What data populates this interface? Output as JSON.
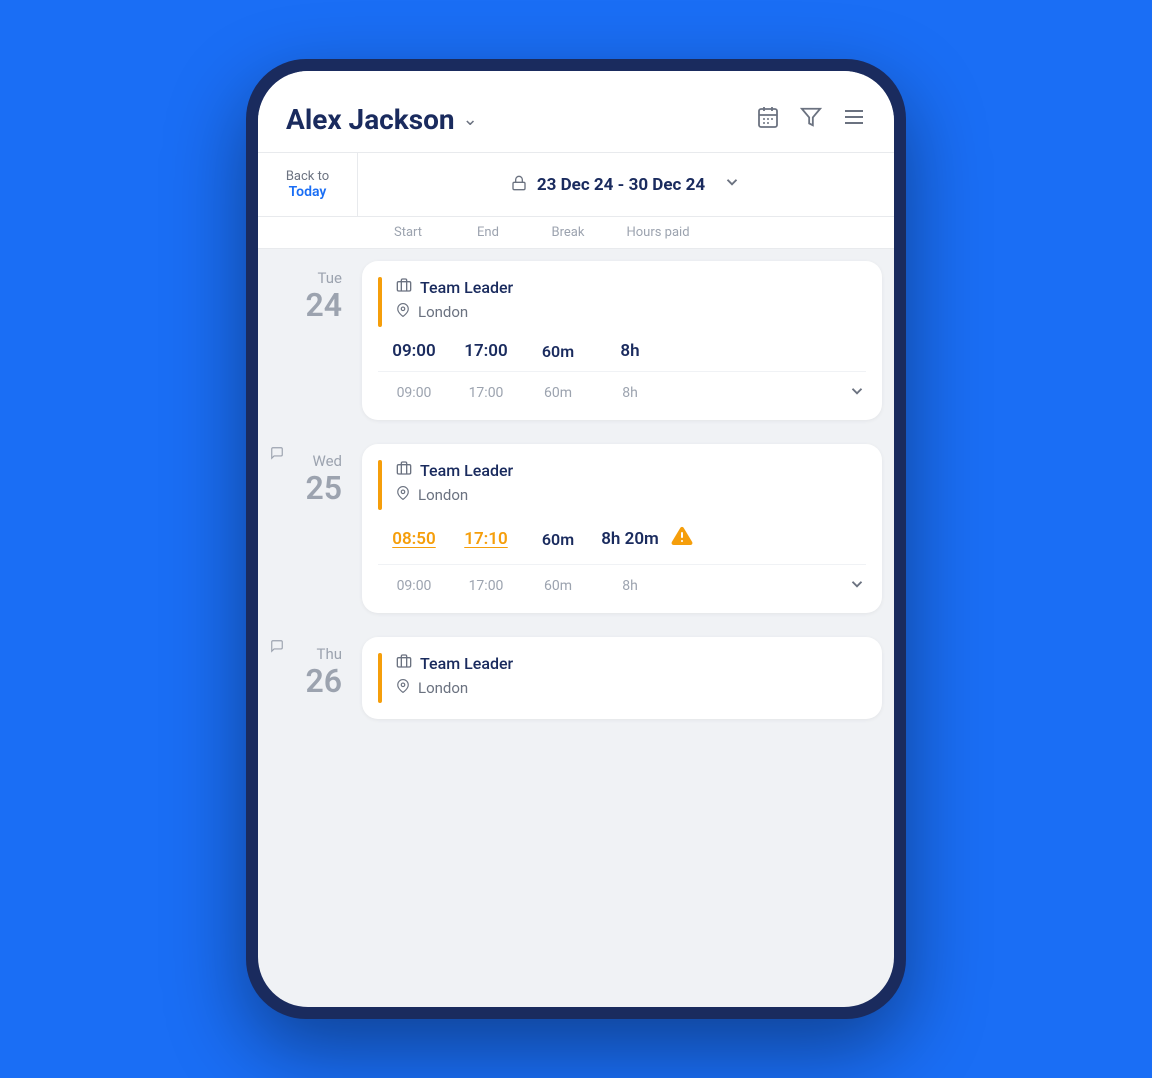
{
  "header": {
    "title": "Alex Jackson",
    "chevron": "⌄",
    "icons": {
      "calendar": "📅",
      "filter": "⊻",
      "menu": "≡"
    }
  },
  "nav": {
    "back_label": "Back to",
    "today_label": "Today",
    "lock_icon": "🔒",
    "week_range": "23 Dec 24 - 30 Dec 24",
    "chevron": "⌄"
  },
  "columns": {
    "start": "Start",
    "end": "End",
    "break": "Break",
    "hours_paid": "Hours paid"
  },
  "days": [
    {
      "day_name": "Tue",
      "day_number": "24",
      "has_comment": false,
      "shifts": [
        {
          "role": "Team Leader",
          "location": "London",
          "start": "09:00",
          "end": "17:00",
          "break": "60m",
          "hours": "8h",
          "start_underline": false,
          "end_underline": false,
          "has_warning": false,
          "scheduled_start": "09:00",
          "scheduled_end": "17:00",
          "scheduled_break": "60m",
          "scheduled_hours": "8h"
        }
      ]
    },
    {
      "day_name": "Wed",
      "day_number": "25",
      "has_comment": true,
      "shifts": [
        {
          "role": "Team Leader",
          "location": "London",
          "start": "08:50",
          "end": "17:10",
          "break": "60m",
          "hours": "8h 20m",
          "start_underline": true,
          "end_underline": true,
          "has_warning": true,
          "scheduled_start": "09:00",
          "scheduled_end": "17:00",
          "scheduled_break": "60m",
          "scheduled_hours": "8h"
        }
      ]
    },
    {
      "day_name": "Thu",
      "day_number": "26",
      "has_comment": true,
      "shifts": [
        {
          "role": "Team Leader",
          "location": "London",
          "start": null,
          "end": null,
          "break": null,
          "hours": null,
          "has_warning": false
        }
      ]
    }
  ]
}
